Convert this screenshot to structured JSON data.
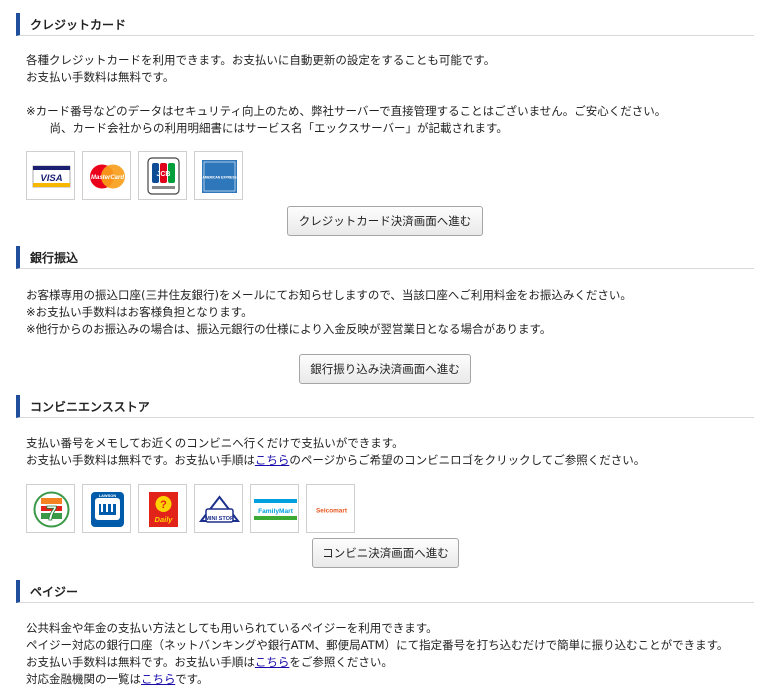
{
  "credit": {
    "title": "クレジットカード",
    "lines": [
      "各種クレジットカードを利用できます。お支払いに自動更新の設定をすることも可能です。",
      "お支払い手数料は無料です。"
    ],
    "notes": [
      "※カード番号などのデータはセキュリティ向上のため、弊社サーバーで直接管理することはございません。ご安心ください。",
      "　尚、カード会社からの利用明細書にはサービス名「エックスサーバー」が記載されます。"
    ],
    "logos": {
      "visa": "VISA",
      "mastercard": "MasterCard",
      "jcb": "JCB",
      "amex": "AMERICAN EXPRESS"
    },
    "button": "クレジットカード決済画面へ進む"
  },
  "bank": {
    "title": "銀行振込",
    "lines": [
      "お客様専用の振込口座(三井住友銀行)をメールにてお知らせしますので、当該口座へご利用料金をお振込みください。",
      "※お支払い手数料はお客様負担となります。",
      "※他行からのお振込みの場合は、振込元銀行の仕様により入金反映が翌営業日となる場合があります。"
    ],
    "button": "銀行振り込み決済画面へ進む"
  },
  "convenience": {
    "title": "コンビニエンスストア",
    "line1": "支払い番号をメモしてお近くのコンビニへ行くだけで支払いができます。",
    "line2_before": "お支払い手数料は無料です。お支払い手順は",
    "line2_link": "こちら",
    "line2_after": "のページからご希望のコンビニロゴをクリックしてご参照ください。",
    "logos": {
      "seven": "7",
      "lawson": "LAWSON",
      "daily": "Daily",
      "ministop": "MINI STOP",
      "familymart": "FamilyMart",
      "seicomart": "Seicomart"
    },
    "button": "コンビニ決済画面へ進む"
  },
  "payeasy": {
    "title": "ペイジー",
    "line1": "公共料金や年金の支払い方法としても用いられているペイジーを利用できます。",
    "line2": "ペイジー対応の銀行口座（ネットバンキングや銀行ATM、郵便局ATM）にて指定番号を打ち込むだけで簡単に振り込むことができます。",
    "line3_before": "お支払い手数料は無料です。お支払い手順は",
    "line3_link": "こちら",
    "line3_after": "をご参照ください。",
    "line4_before": "対応金融機関の一覧は",
    "line4_link": "こちら",
    "line4_after": "です。"
  }
}
